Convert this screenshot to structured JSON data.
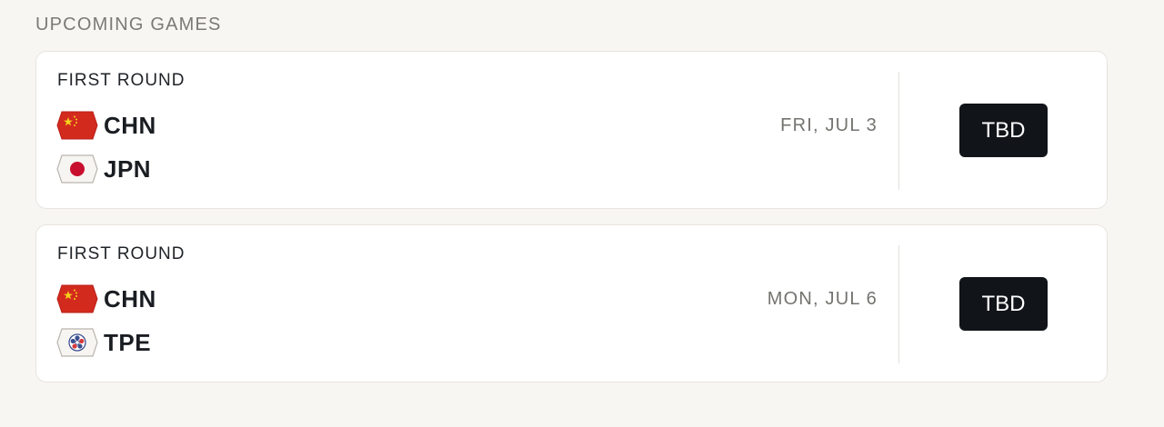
{
  "section": {
    "title": "UPCOMING GAMES"
  },
  "games": [
    {
      "round": "FIRST ROUND",
      "teams": [
        {
          "code": "CHN",
          "flag_icon": "china-flag-icon"
        },
        {
          "code": "JPN",
          "flag_icon": "japan-flag-icon"
        }
      ],
      "date": "FRI, JUL 3",
      "status_label": "TBD"
    },
    {
      "round": "FIRST ROUND",
      "teams": [
        {
          "code": "CHN",
          "flag_icon": "china-flag-icon"
        },
        {
          "code": "TPE",
          "flag_icon": "chinese-taipei-flag-icon"
        }
      ],
      "date": "MON, JUL 6",
      "status_label": "TBD"
    }
  ],
  "colors": {
    "page_background": "#f8f6f3",
    "card_background": "#ffffff",
    "button_background": "#111419",
    "button_text": "#ffffff",
    "muted_text": "#75736f"
  }
}
